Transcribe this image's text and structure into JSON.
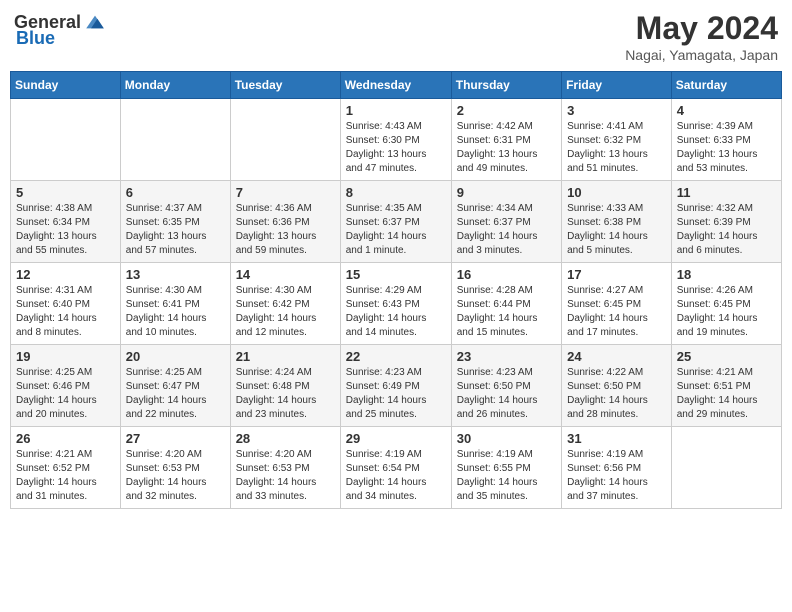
{
  "header": {
    "logo_general": "General",
    "logo_blue": "Blue",
    "month_year": "May 2024",
    "location": "Nagai, Yamagata, Japan"
  },
  "weekdays": [
    "Sunday",
    "Monday",
    "Tuesday",
    "Wednesday",
    "Thursday",
    "Friday",
    "Saturday"
  ],
  "weeks": [
    [
      {
        "day": "",
        "info": ""
      },
      {
        "day": "",
        "info": ""
      },
      {
        "day": "",
        "info": ""
      },
      {
        "day": "1",
        "info": "Sunrise: 4:43 AM\nSunset: 6:30 PM\nDaylight: 13 hours\nand 47 minutes."
      },
      {
        "day": "2",
        "info": "Sunrise: 4:42 AM\nSunset: 6:31 PM\nDaylight: 13 hours\nand 49 minutes."
      },
      {
        "day": "3",
        "info": "Sunrise: 4:41 AM\nSunset: 6:32 PM\nDaylight: 13 hours\nand 51 minutes."
      },
      {
        "day": "4",
        "info": "Sunrise: 4:39 AM\nSunset: 6:33 PM\nDaylight: 13 hours\nand 53 minutes."
      }
    ],
    [
      {
        "day": "5",
        "info": "Sunrise: 4:38 AM\nSunset: 6:34 PM\nDaylight: 13 hours\nand 55 minutes."
      },
      {
        "day": "6",
        "info": "Sunrise: 4:37 AM\nSunset: 6:35 PM\nDaylight: 13 hours\nand 57 minutes."
      },
      {
        "day": "7",
        "info": "Sunrise: 4:36 AM\nSunset: 6:36 PM\nDaylight: 13 hours\nand 59 minutes."
      },
      {
        "day": "8",
        "info": "Sunrise: 4:35 AM\nSunset: 6:37 PM\nDaylight: 14 hours\nand 1 minute."
      },
      {
        "day": "9",
        "info": "Sunrise: 4:34 AM\nSunset: 6:37 PM\nDaylight: 14 hours\nand 3 minutes."
      },
      {
        "day": "10",
        "info": "Sunrise: 4:33 AM\nSunset: 6:38 PM\nDaylight: 14 hours\nand 5 minutes."
      },
      {
        "day": "11",
        "info": "Sunrise: 4:32 AM\nSunset: 6:39 PM\nDaylight: 14 hours\nand 6 minutes."
      }
    ],
    [
      {
        "day": "12",
        "info": "Sunrise: 4:31 AM\nSunset: 6:40 PM\nDaylight: 14 hours\nand 8 minutes."
      },
      {
        "day": "13",
        "info": "Sunrise: 4:30 AM\nSunset: 6:41 PM\nDaylight: 14 hours\nand 10 minutes."
      },
      {
        "day": "14",
        "info": "Sunrise: 4:30 AM\nSunset: 6:42 PM\nDaylight: 14 hours\nand 12 minutes."
      },
      {
        "day": "15",
        "info": "Sunrise: 4:29 AM\nSunset: 6:43 PM\nDaylight: 14 hours\nand 14 minutes."
      },
      {
        "day": "16",
        "info": "Sunrise: 4:28 AM\nSunset: 6:44 PM\nDaylight: 14 hours\nand 15 minutes."
      },
      {
        "day": "17",
        "info": "Sunrise: 4:27 AM\nSunset: 6:45 PM\nDaylight: 14 hours\nand 17 minutes."
      },
      {
        "day": "18",
        "info": "Sunrise: 4:26 AM\nSunset: 6:45 PM\nDaylight: 14 hours\nand 19 minutes."
      }
    ],
    [
      {
        "day": "19",
        "info": "Sunrise: 4:25 AM\nSunset: 6:46 PM\nDaylight: 14 hours\nand 20 minutes."
      },
      {
        "day": "20",
        "info": "Sunrise: 4:25 AM\nSunset: 6:47 PM\nDaylight: 14 hours\nand 22 minutes."
      },
      {
        "day": "21",
        "info": "Sunrise: 4:24 AM\nSunset: 6:48 PM\nDaylight: 14 hours\nand 23 minutes."
      },
      {
        "day": "22",
        "info": "Sunrise: 4:23 AM\nSunset: 6:49 PM\nDaylight: 14 hours\nand 25 minutes."
      },
      {
        "day": "23",
        "info": "Sunrise: 4:23 AM\nSunset: 6:50 PM\nDaylight: 14 hours\nand 26 minutes."
      },
      {
        "day": "24",
        "info": "Sunrise: 4:22 AM\nSunset: 6:50 PM\nDaylight: 14 hours\nand 28 minutes."
      },
      {
        "day": "25",
        "info": "Sunrise: 4:21 AM\nSunset: 6:51 PM\nDaylight: 14 hours\nand 29 minutes."
      }
    ],
    [
      {
        "day": "26",
        "info": "Sunrise: 4:21 AM\nSunset: 6:52 PM\nDaylight: 14 hours\nand 31 minutes."
      },
      {
        "day": "27",
        "info": "Sunrise: 4:20 AM\nSunset: 6:53 PM\nDaylight: 14 hours\nand 32 minutes."
      },
      {
        "day": "28",
        "info": "Sunrise: 4:20 AM\nSunset: 6:53 PM\nDaylight: 14 hours\nand 33 minutes."
      },
      {
        "day": "29",
        "info": "Sunrise: 4:19 AM\nSunset: 6:54 PM\nDaylight: 14 hours\nand 34 minutes."
      },
      {
        "day": "30",
        "info": "Sunrise: 4:19 AM\nSunset: 6:55 PM\nDaylight: 14 hours\nand 35 minutes."
      },
      {
        "day": "31",
        "info": "Sunrise: 4:19 AM\nSunset: 6:56 PM\nDaylight: 14 hours\nand 37 minutes."
      },
      {
        "day": "",
        "info": ""
      }
    ]
  ]
}
